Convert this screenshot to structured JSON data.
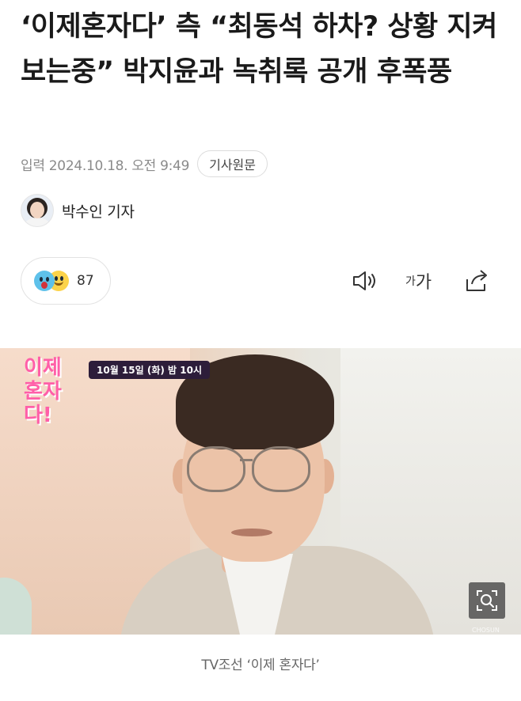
{
  "article": {
    "title": "‘이제혼자다’ 측 “최동석 하차? 상황 지켜보는중” 박지윤과 녹취록 공개 후폭풍",
    "published": "입력 2024.10.18. 오전 9:49",
    "original_button": "기사원문",
    "reporter": "박수인 기자"
  },
  "reaction": {
    "count": "87",
    "icons": [
      "surprised-emoji",
      "smile-emoji"
    ]
  },
  "toolbar": {
    "font_small": "가",
    "font_large": "가",
    "icons": [
      "speaker-icon",
      "font-size-icon",
      "share-icon"
    ]
  },
  "photo": {
    "show_logo": "이제 혼자다!",
    "air_banner": "10월 15일 (화) 밤 10시",
    "corner_logo": "CHOSUN",
    "zoom_icon": "zoom-icon"
  },
  "caption": "TV조선 ‘이제 혼자다’",
  "colors": {
    "meta_text": "#8a8a8a",
    "logo_pink": "#ff5fa8",
    "reaction_blue": "#5ec1ea",
    "reaction_yellow": "#fcd34a"
  }
}
